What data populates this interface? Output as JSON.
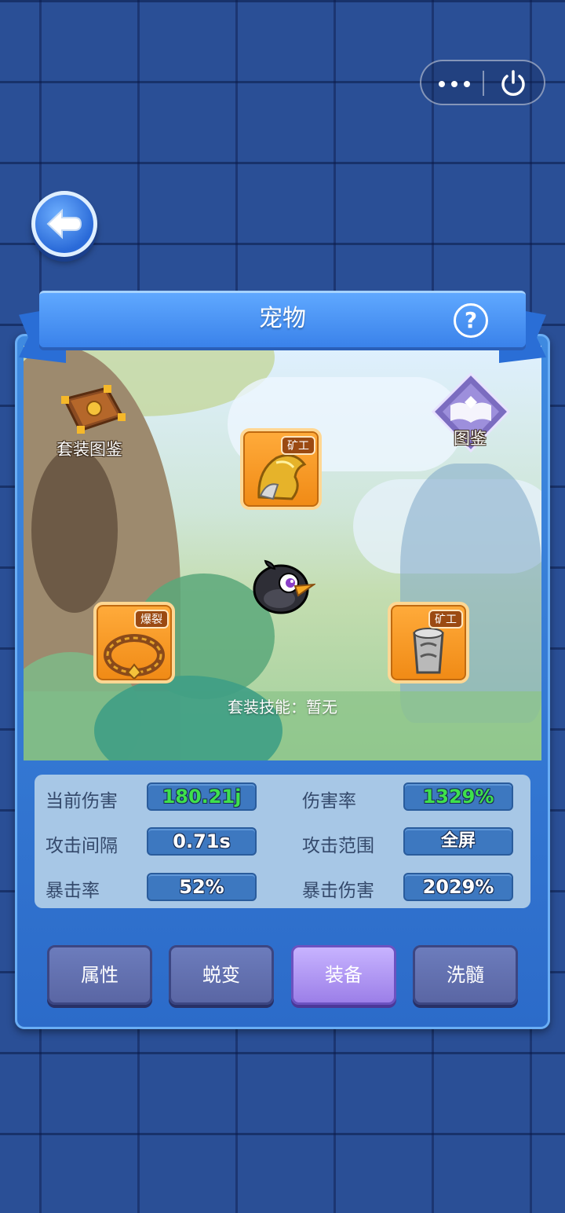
{
  "header": {
    "title": "宠物",
    "help_symbol": "?"
  },
  "scene": {
    "set_gallery_label": "套装图鉴",
    "gallery_label": "图鉴",
    "set_skill_text": "套装技能：暂无",
    "slots": [
      {
        "tag": "矿工",
        "item": "golden helmet"
      },
      {
        "tag": "爆裂",
        "item": "jeweled collar"
      },
      {
        "tag": "矿工",
        "item": "silver bracer"
      }
    ]
  },
  "stats": {
    "current_damage": {
      "label": "当前伤害",
      "value": "180.21j"
    },
    "damage_rate": {
      "label": "伤害率",
      "value": "1329%"
    },
    "attack_interval": {
      "label": "攻击间隔",
      "value": "0.71s"
    },
    "attack_range": {
      "label": "攻击范围",
      "value": "全屏"
    },
    "crit_rate": {
      "label": "暴击率",
      "value": "52%"
    },
    "crit_damage": {
      "label": "暴击伤害",
      "value": "2029%"
    }
  },
  "tabs": [
    {
      "label": "属性",
      "active": false
    },
    {
      "label": "蜕变",
      "active": false
    },
    {
      "label": "装备",
      "active": true
    },
    {
      "label": "洗髓",
      "active": false
    }
  ],
  "colors": {
    "panel_blue": "#3f8ae0",
    "slot_orange": "#f08a15",
    "active_tab": "#9c7fe8",
    "stat_green": "#3ee04c"
  }
}
